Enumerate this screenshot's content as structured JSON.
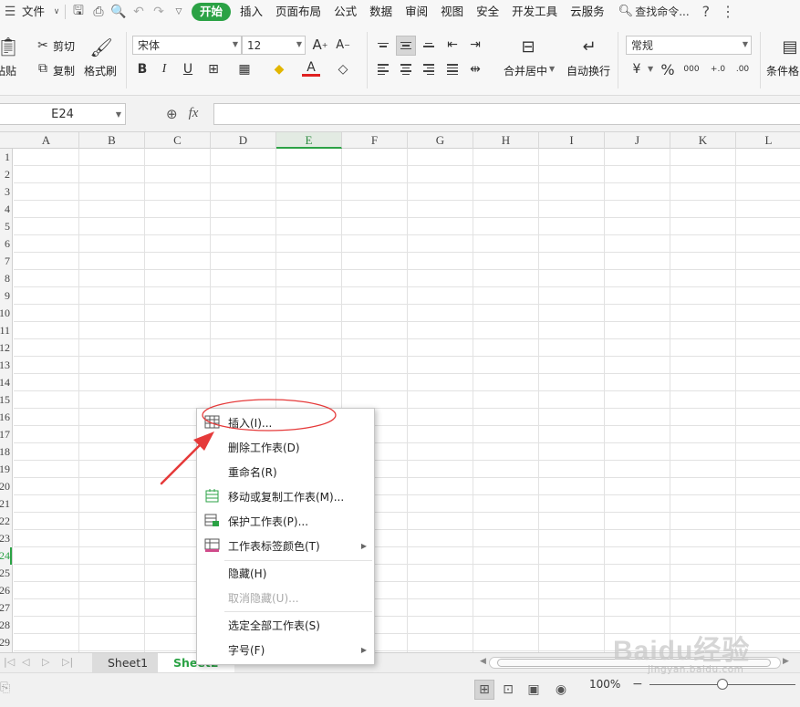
{
  "menubar": {
    "file": "文件",
    "tabs": [
      "开始",
      "插入",
      "页面布局",
      "公式",
      "数据",
      "审阅",
      "视图",
      "安全",
      "开发工具",
      "云服务"
    ],
    "active_tab": "开始",
    "search": "查找命令..."
  },
  "ribbon": {
    "paste": "粘贴",
    "cut": "剪切",
    "copy": "复制",
    "format_painter": "格式刷",
    "font_name": "宋体",
    "font_size": "12",
    "merge_center": "合并居中",
    "wrap_text": "自动换行",
    "number_format": "常规",
    "conditional_format": "条件格"
  },
  "formula_bar": {
    "cell_ref": "E24",
    "fx": "fx"
  },
  "columns": [
    "A",
    "B",
    "C",
    "D",
    "E",
    "F",
    "G",
    "H",
    "I",
    "J",
    "K",
    "L"
  ],
  "active_column": "E",
  "rows": [
    "1",
    "2",
    "3",
    "4",
    "5",
    "6",
    "7",
    "8",
    "9",
    "10",
    "11",
    "12",
    "13",
    "14",
    "15",
    "16",
    "17",
    "18",
    "19",
    "20",
    "21",
    "22",
    "23",
    "24",
    "25",
    "26",
    "27",
    "28",
    "29"
  ],
  "active_row": "24",
  "sheets": {
    "tabs": [
      "Sheet1",
      "Sheet2"
    ],
    "active": "Sheet2"
  },
  "context_menu": {
    "insert": "插入(I)...",
    "delete_sheet": "删除工作表(D)",
    "rename": "重命名(R)",
    "move_copy": "移动或复制工作表(M)...",
    "protect": "保护工作表(P)...",
    "tab_color": "工作表标签颜色(T)",
    "hide": "隐藏(H)",
    "unhide": "取消隐藏(U)...",
    "select_all": "选定全部工作表(S)",
    "font_size": "字号(F)"
  },
  "status_bar": {
    "zoom": "100%"
  },
  "watermark": {
    "logo": "Baidu经验",
    "url": "jingyan.baidu.com"
  },
  "colors": {
    "accent": "#2ba245",
    "annotation": "#e53a3a"
  }
}
